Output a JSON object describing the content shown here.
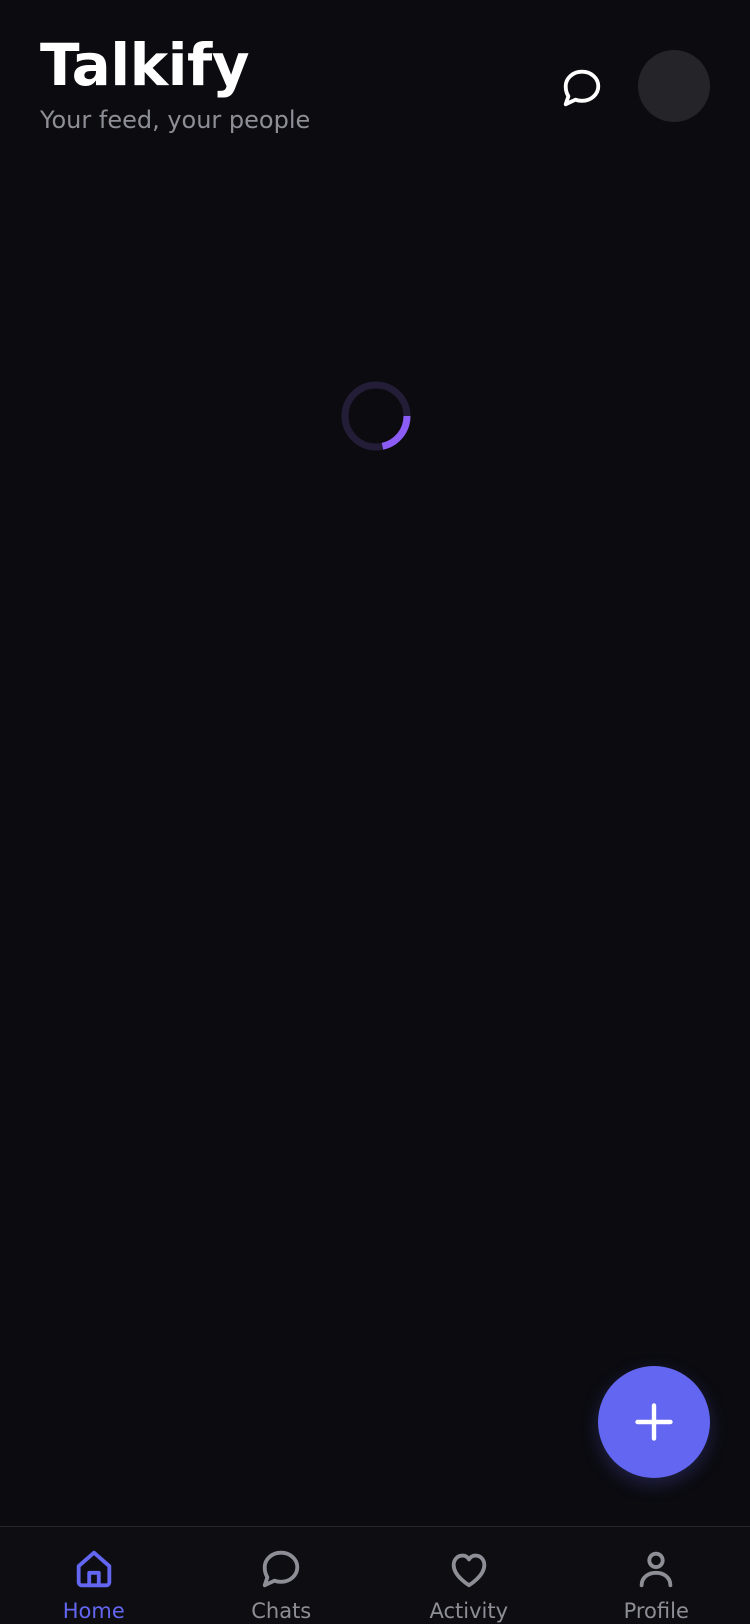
{
  "app": {
    "title": "Talkify",
    "subtitle": "Your feed, your people"
  },
  "header": {
    "chat_icon": "chat-bubble-icon",
    "avatar": "avatar-placeholder"
  },
  "feed": {
    "state": "loading",
    "spinner_color": "#8b5cf6",
    "spinner_track_color": "#231d38"
  },
  "fab": {
    "icon": "plus-icon",
    "color": "#6366f1"
  },
  "bottom_nav": {
    "active_color": "#6366f1",
    "inactive_color": "#8e8e96",
    "items": [
      {
        "label": "Home",
        "icon": "home-icon",
        "active": true
      },
      {
        "label": "Chats",
        "icon": "chat-bubble-icon",
        "active": false
      },
      {
        "label": "Activity",
        "icon": "heart-icon",
        "active": false
      },
      {
        "label": "Profile",
        "icon": "user-icon",
        "active": false
      }
    ]
  }
}
